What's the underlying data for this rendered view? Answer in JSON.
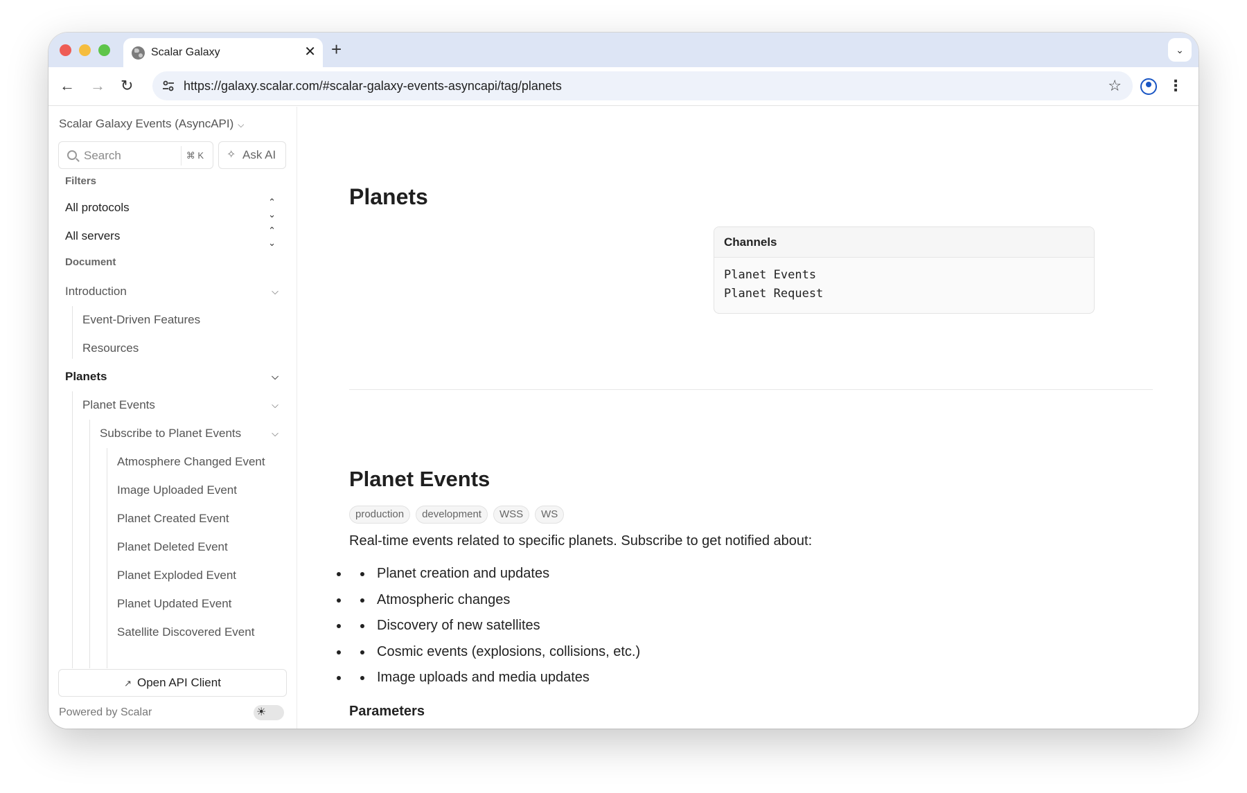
{
  "browser": {
    "tab_title": "Scalar Galaxy",
    "new_tab_symbol": "+",
    "close_symbol": "✕",
    "url": "https://galaxy.scalar.com/#scalar-galaxy-events-asyncapi/tag/planets"
  },
  "sidebar": {
    "title": "Scalar Galaxy Events (AsyncAPI)",
    "search_placeholder": "Search",
    "search_shortcut": "⌘ K",
    "ask_ai_label": "Ask AI",
    "filters_heading": "Filters",
    "protocol_filter": "All protocols",
    "server_filter": "All servers",
    "document_heading": "Document",
    "nav": {
      "introduction": "Introduction",
      "event_driven": "Event-Driven Features",
      "resources": "Resources",
      "planets": "Planets",
      "planet_events": "Planet Events",
      "subscribe": "Subscribe to Planet Events",
      "events": [
        "Atmosphere Changed Event",
        "Image Uploaded Event",
        "Planet Created Event",
        "Planet Deleted Event",
        "Planet Exploded Event",
        "Planet Updated Event",
        "Satellite Discovered Event"
      ]
    },
    "open_api_client": "Open API Client",
    "footer": "Powered by Scalar"
  },
  "main": {
    "title": "Planets",
    "channels_card": {
      "heading": "Channels",
      "items": [
        "Planet Events",
        "Planet Request"
      ]
    },
    "section": {
      "title": "Planet Events",
      "badges": [
        "production",
        "development",
        "WSS",
        "WS"
      ],
      "description": "Real-time events related to specific planets. Subscribe to get notified about:",
      "bullets": [
        "Planet creation and updates",
        "Atmospheric changes",
        "Discovery of new satellites",
        "Cosmic events (explosions, collisions, etc.)",
        "Image uploads and media updates"
      ],
      "next_heading": "Parameters"
    }
  }
}
